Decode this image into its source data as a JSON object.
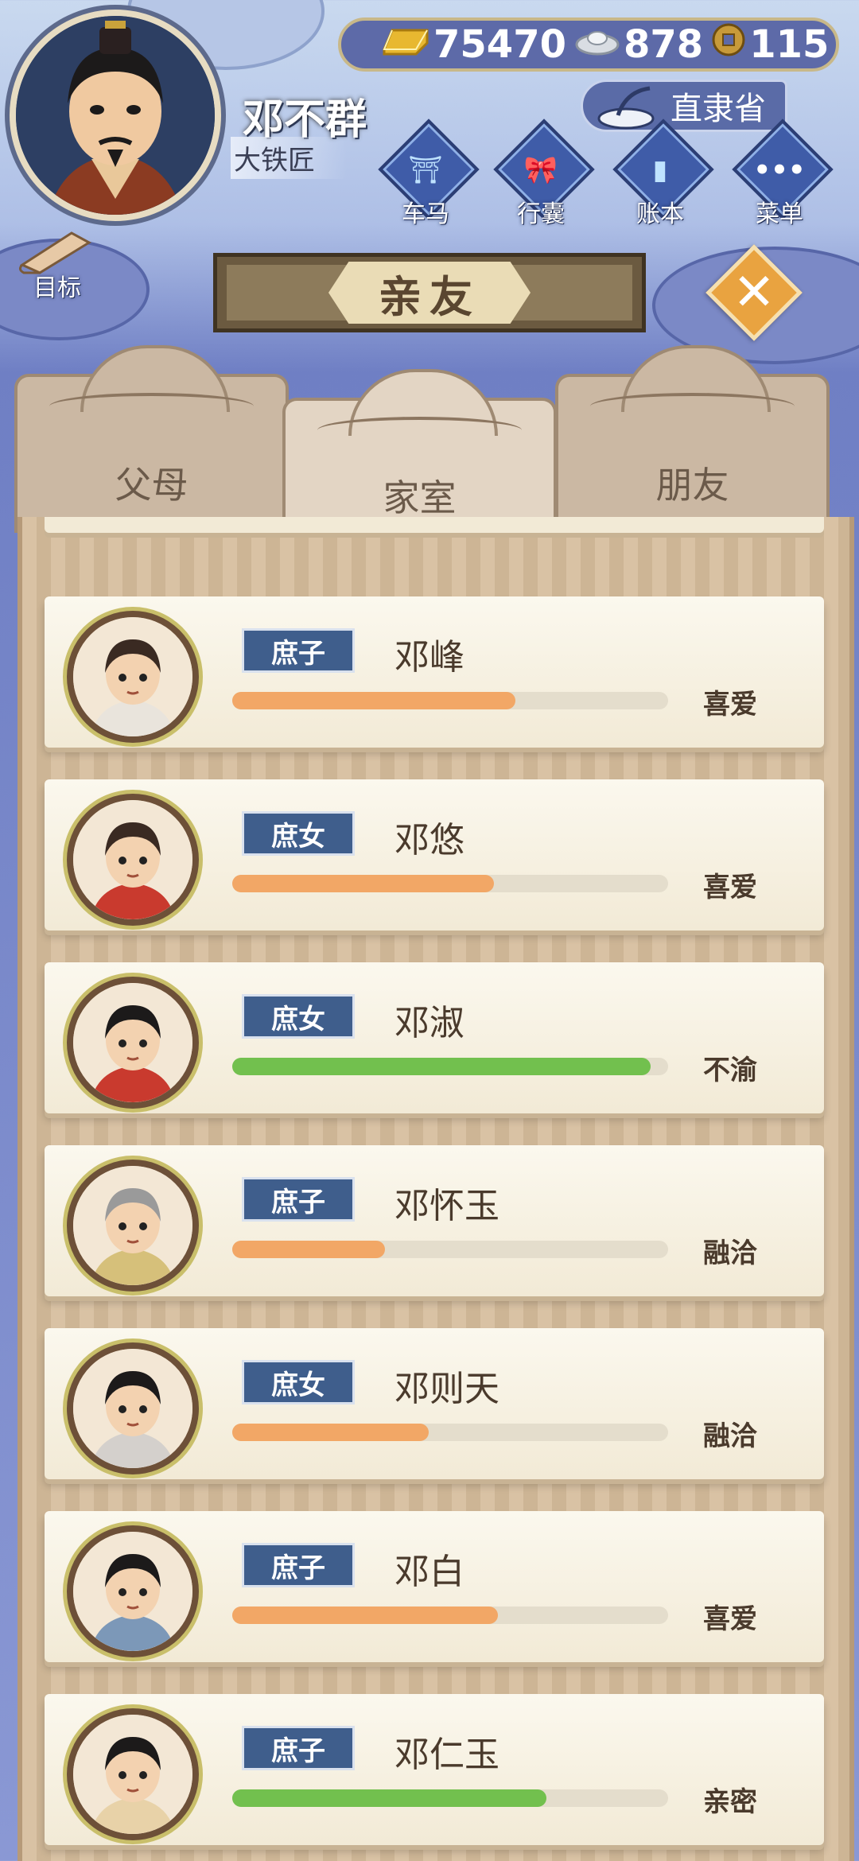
{
  "hud": {
    "player_name": "邓不群",
    "player_title": "大铁匠",
    "currencies": {
      "gold": "75470",
      "silver": "878",
      "coin": "115"
    },
    "province": "直隶省",
    "buttons": [
      {
        "label": "车马",
        "icon": "carriage-icon"
      },
      {
        "label": "行囊",
        "icon": "bag-icon"
      },
      {
        "label": "账本",
        "icon": "ledger-icon"
      },
      {
        "label": "菜单",
        "icon": "menu-dots-icon"
      }
    ],
    "goal_label": "目标"
  },
  "title": "亲友",
  "tabs": [
    {
      "label": "父母",
      "active": false
    },
    {
      "label": "家室",
      "active": true
    },
    {
      "label": "朋友",
      "active": false
    }
  ],
  "members": [
    {
      "role": "庶子",
      "name": "邓峰",
      "status": "喜爱",
      "affinity": 0.65,
      "bar_color": "#f2a766"
    },
    {
      "role": "庶女",
      "name": "邓悠",
      "status": "喜爱",
      "affinity": 0.6,
      "bar_color": "#f2a766"
    },
    {
      "role": "庶女",
      "name": "邓淑",
      "status": "不渝",
      "affinity": 0.96,
      "bar_color": "#72c04e"
    },
    {
      "role": "庶子",
      "name": "邓怀玉",
      "status": "融洽",
      "affinity": 0.35,
      "bar_color": "#f2a766"
    },
    {
      "role": "庶女",
      "name": "邓则天",
      "status": "融洽",
      "affinity": 0.45,
      "bar_color": "#f2a766"
    },
    {
      "role": "庶子",
      "name": "邓白",
      "status": "喜爱",
      "affinity": 0.61,
      "bar_color": "#f2a766"
    },
    {
      "role": "庶子",
      "name": "邓仁玉",
      "status": "亲密",
      "affinity": 0.72,
      "bar_color": "#72c04e"
    }
  ],
  "colors": {
    "panel": "#d9c2a4",
    "badge": "#3f5e8c",
    "orange": "#f2a766",
    "green": "#72c04e"
  }
}
